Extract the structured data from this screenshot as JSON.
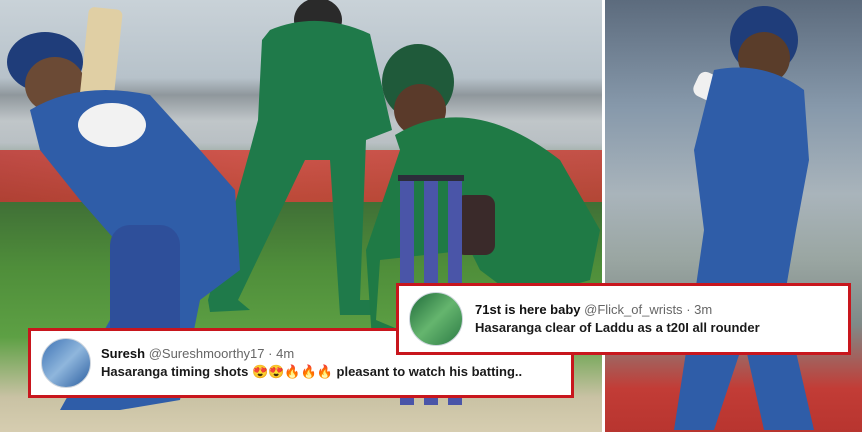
{
  "tweets": [
    {
      "display_name": "Suresh",
      "handle": "@Sureshmoorthy17",
      "separator": "·",
      "time": "4m",
      "text": "Hasaranga timing shots 😍😍🔥🔥🔥 pleasant to watch his batting.."
    },
    {
      "display_name": "71st is here baby",
      "handle": "@Flick_of_wrists",
      "separator": "·",
      "time": "3m",
      "text": "Hasaranga clear of Laddu as a t20I all rounder"
    }
  ],
  "colors": {
    "tweet_border": "#c8161d",
    "srilanka_kit": "#2f5da8",
    "pakistan_kit": "#1e7a45"
  }
}
